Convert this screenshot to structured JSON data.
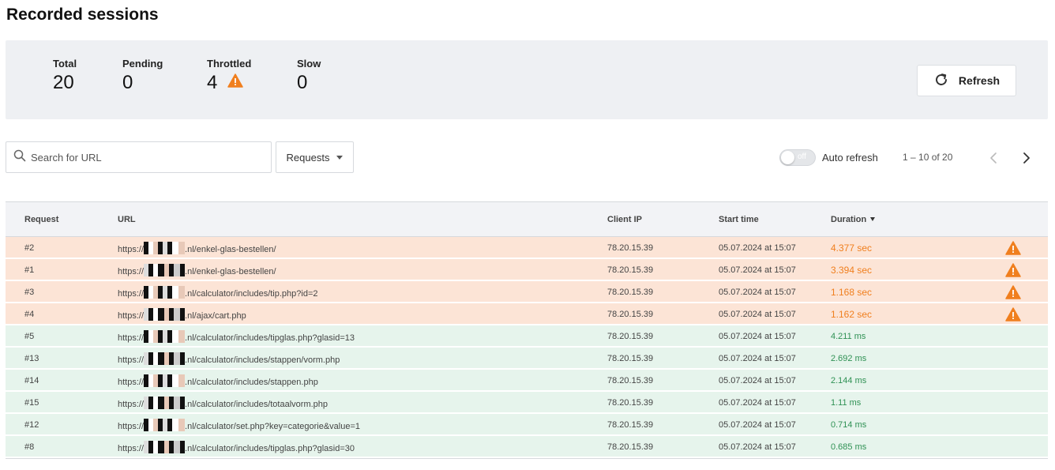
{
  "page": {
    "title": "Recorded sessions"
  },
  "stats": {
    "total_label": "Total",
    "total_value": "20",
    "pending_label": "Pending",
    "pending_value": "0",
    "throttled_label": "Throttled",
    "throttled_value": "4",
    "slow_label": "Slow",
    "slow_value": "0"
  },
  "toolbar": {
    "refresh_label": "Refresh",
    "search_placeholder": "Search for URL",
    "type_filter": "Requests",
    "auto_refresh_label": "Auto refresh",
    "auto_refresh_state": "off",
    "pagination": "1 – 10 of 20"
  },
  "colors": {
    "warning": "#f07f1e",
    "slow_row": "#fce4d6",
    "ok_row": "#e6f4ec",
    "ok_text": "#2f9154"
  },
  "icons": {
    "refresh": "refresh-icon",
    "search": "search-icon",
    "warning": "warning-triangle-icon",
    "prev": "chevron-left-icon",
    "next": "chevron-right-icon"
  },
  "table": {
    "headers": {
      "request": "Request",
      "url": "URL",
      "client_ip": "Client IP",
      "start_time": "Start time",
      "duration": "Duration"
    },
    "rows": [
      {
        "request": "#2",
        "url_prefix": "https://",
        "url_suffix": ".nl/enkel-glas-bestellen/",
        "client_ip": "78.20.15.39",
        "start_time": "05.07.2024 at 15:07",
        "duration": "4.377 sec",
        "status": "slow"
      },
      {
        "request": "#1",
        "url_prefix": "https://",
        "url_suffix": ".nl/enkel-glas-bestellen/",
        "client_ip": "78.20.15.39",
        "start_time": "05.07.2024 at 15:07",
        "duration": "3.394 sec",
        "status": "slow"
      },
      {
        "request": "#3",
        "url_prefix": "https://",
        "url_suffix": ".nl/calculator/includes/tip.php?id=2",
        "client_ip": "78.20.15.39",
        "start_time": "05.07.2024 at 15:07",
        "duration": "1.168 sec",
        "status": "slow"
      },
      {
        "request": "#4",
        "url_prefix": "https://",
        "url_suffix": ".nl/ajax/cart.php",
        "client_ip": "78.20.15.39",
        "start_time": "05.07.2024 at 15:07",
        "duration": "1.162 sec",
        "status": "slow"
      },
      {
        "request": "#5",
        "url_prefix": "https://",
        "url_suffix": ".nl/calculator/includes/tipglas.php?glasid=13",
        "client_ip": "78.20.15.39",
        "start_time": "05.07.2024 at 15:07",
        "duration": "4.211 ms",
        "status": "ok"
      },
      {
        "request": "#13",
        "url_prefix": "https://",
        "url_suffix": ".nl/calculator/includes/stappen/vorm.php",
        "client_ip": "78.20.15.39",
        "start_time": "05.07.2024 at 15:07",
        "duration": "2.692 ms",
        "status": "ok"
      },
      {
        "request": "#14",
        "url_prefix": "https://",
        "url_suffix": ".nl/calculator/includes/stappen.php",
        "client_ip": "78.20.15.39",
        "start_time": "05.07.2024 at 15:07",
        "duration": "2.144 ms",
        "status": "ok"
      },
      {
        "request": "#15",
        "url_prefix": "https://",
        "url_suffix": ".nl/calculator/includes/totaalvorm.php",
        "client_ip": "78.20.15.39",
        "start_time": "05.07.2024 at 15:07",
        "duration": "1.11 ms",
        "status": "ok"
      },
      {
        "request": "#12",
        "url_prefix": "https://",
        "url_suffix": ".nl/calculator/set.php?key=categorie&value=1",
        "client_ip": "78.20.15.39",
        "start_time": "05.07.2024 at 15:07",
        "duration": "0.714 ms",
        "status": "ok"
      },
      {
        "request": "#8",
        "url_prefix": "https://",
        "url_suffix": ".nl/calculator/includes/tipglas.php?glasid=30",
        "client_ip": "78.20.15.39",
        "start_time": "05.07.2024 at 15:07",
        "duration": "0.685 ms",
        "status": "ok"
      }
    ]
  }
}
